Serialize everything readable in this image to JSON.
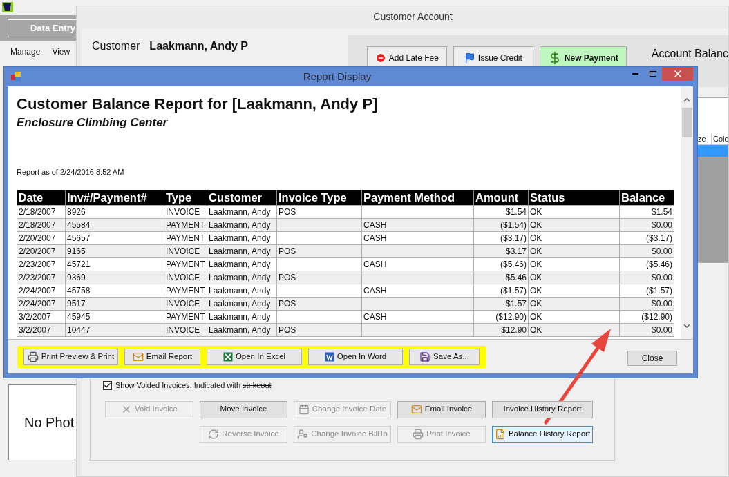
{
  "app": {
    "nav_button": "Data Entry",
    "menu": [
      "Manage",
      "View"
    ],
    "photo_placeholder": "No Phot"
  },
  "customer_window": {
    "title": "Customer Account",
    "customer_label": "Customer",
    "customer_name": "Laakmann, Andy P",
    "actions": [
      {
        "label": "Add Late Fee",
        "kind": "late_fee",
        "primary": false
      },
      {
        "label": "Issue Credit",
        "kind": "credit",
        "primary": false
      },
      {
        "label": "New Payment",
        "kind": "payment",
        "primary": true
      }
    ],
    "account_balance_label": "Account Balanc",
    "grid_columns": [
      "ze",
      "Colo"
    ],
    "show_voided": {
      "checked": true,
      "label": "Show Voided Invoices. Indicated with",
      "example": "strikeout"
    },
    "button_rows": [
      [
        {
          "label": "Void Invoice",
          "kind": "void",
          "disabled": true,
          "focused": false
        },
        {
          "label": "Move Invoice",
          "kind": "none",
          "disabled": false,
          "focused": false
        },
        {
          "label": "Change Invoice Date",
          "kind": "calendar",
          "disabled": true,
          "focused": false
        },
        {
          "label": "Email Invoice",
          "kind": "email",
          "disabled": false,
          "focused": false
        },
        {
          "label": "Invoice History Report",
          "kind": "none",
          "disabled": false,
          "focused": false
        }
      ],
      [
        {
          "label": "Reverse Invoice",
          "kind": "reverse",
          "disabled": true,
          "focused": false
        },
        {
          "label": "Change Invoice BillTo",
          "kind": "user",
          "disabled": true,
          "focused": false
        },
        {
          "label": "Print Invoice",
          "kind": "print",
          "disabled": true,
          "focused": false
        },
        {
          "label": "Balance History Report",
          "kind": "report",
          "disabled": false,
          "focused": true
        }
      ]
    ]
  },
  "report_window": {
    "title": "Report Display",
    "report_title": "Customer Balance Report for [Laakmann, Andy P]",
    "subtitle": "Enclosure Climbing Center",
    "report_as_of": "Report as of 2/24/2016 8:52 AM",
    "columns": [
      "Date",
      "Inv#/Payment#",
      "Type",
      "Customer",
      "Invoice Type",
      "Payment Method",
      "Amount",
      "Status",
      "Balance"
    ],
    "rows": [
      [
        "2/18/2007",
        "8926",
        "INVOICE",
        "Laakmann, Andy",
        "POS",
        "",
        "$1.54",
        "OK",
        "$1.54"
      ],
      [
        "2/18/2007",
        "45584",
        "PAYMENT",
        "Laakmann, Andy",
        "",
        "CASH",
        "($1.54)",
        "OK",
        "$0.00"
      ],
      [
        "2/20/2007",
        "45657",
        "PAYMENT",
        "Laakmann, Andy",
        "",
        "CASH",
        "($3.17)",
        "OK",
        "($3.17)"
      ],
      [
        "2/20/2007",
        "9165",
        "INVOICE",
        "Laakmann, Andy",
        "POS",
        "",
        "$3.17",
        "OK",
        "$0.00"
      ],
      [
        "2/23/2007",
        "45721",
        "PAYMENT",
        "Laakmann, Andy",
        "",
        "CASH",
        "($5.46)",
        "OK",
        "($5.46)"
      ],
      [
        "2/23/2007",
        "9369",
        "INVOICE",
        "Laakmann, Andy",
        "POS",
        "",
        "$5.46",
        "OK",
        "$0.00"
      ],
      [
        "2/24/2007",
        "45758",
        "PAYMENT",
        "Laakmann, Andy",
        "",
        "CASH",
        "($1.57)",
        "OK",
        "($1.57)"
      ],
      [
        "2/24/2007",
        "9517",
        "INVOICE",
        "Laakmann, Andy",
        "POS",
        "",
        "$1.57",
        "OK",
        "$0.00"
      ],
      [
        "3/2/2007",
        "45945",
        "PAYMENT",
        "Laakmann, Andy",
        "",
        "CASH",
        "($12.90)",
        "OK",
        "($12.90)"
      ],
      [
        "3/2/2007",
        "10447",
        "INVOICE",
        "Laakmann, Andy",
        "POS",
        "",
        "$12.90",
        "OK",
        "$0.00"
      ]
    ],
    "toolbar": [
      {
        "label": "Print Preview & Print",
        "kind": "print"
      },
      {
        "label": "Email Report",
        "kind": "email"
      },
      {
        "label": "Open In Excel",
        "kind": "excel"
      },
      {
        "label": "Open In Word",
        "kind": "word"
      },
      {
        "label": "Save As...",
        "kind": "save"
      }
    ],
    "close_button": "Close"
  }
}
